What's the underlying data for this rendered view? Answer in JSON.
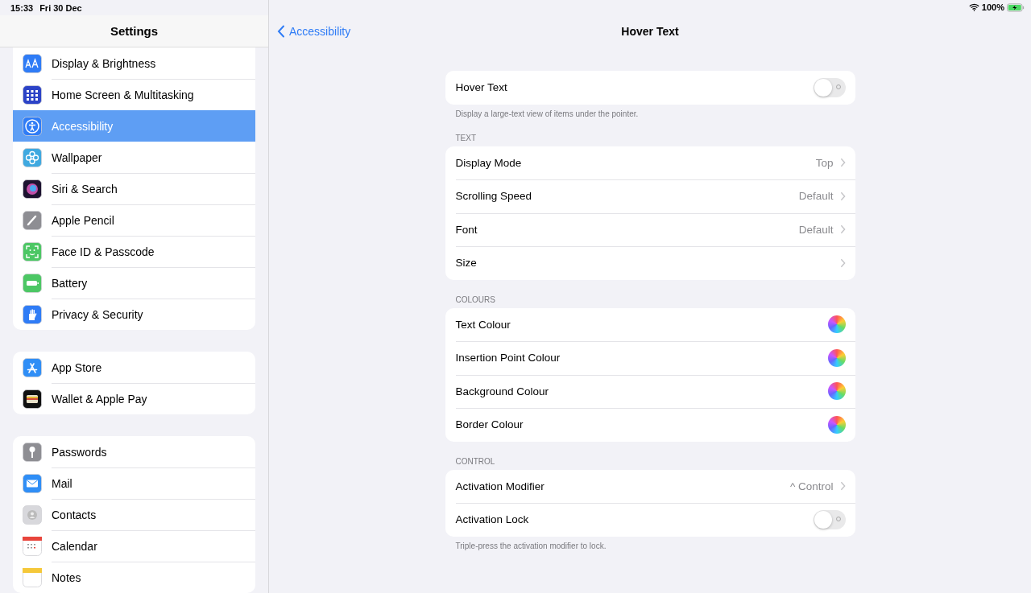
{
  "status_bar": {
    "time": "15:33",
    "date": "Fri 30 Dec",
    "battery": "100%"
  },
  "sidebar": {
    "title": "Settings",
    "groups": [
      [
        {
          "label": "Display & Brightness",
          "kind": "display",
          "selected": false
        },
        {
          "label": "Home Screen & Multitasking",
          "kind": "home",
          "selected": false
        },
        {
          "label": "Accessibility",
          "kind": "accessibility",
          "selected": true
        },
        {
          "label": "Wallpaper",
          "kind": "wallpaper",
          "selected": false
        },
        {
          "label": "Siri & Search",
          "kind": "siri",
          "selected": false
        },
        {
          "label": "Apple Pencil",
          "kind": "pencil",
          "selected": false
        },
        {
          "label": "Face ID & Passcode",
          "kind": "faceid",
          "selected": false
        },
        {
          "label": "Battery",
          "kind": "battery",
          "selected": false
        },
        {
          "label": "Privacy & Security",
          "kind": "privacy",
          "selected": false
        }
      ],
      [
        {
          "label": "App Store",
          "kind": "appstore",
          "selected": false
        },
        {
          "label": "Wallet & Apple Pay",
          "kind": "wallet",
          "selected": false
        }
      ],
      [
        {
          "label": "Passwords",
          "kind": "passwords",
          "selected": false
        },
        {
          "label": "Mail",
          "kind": "mail",
          "selected": false
        },
        {
          "label": "Contacts",
          "kind": "contacts",
          "selected": false
        },
        {
          "label": "Calendar",
          "kind": "calendar",
          "selected": false
        },
        {
          "label": "Notes",
          "kind": "notes",
          "selected": false
        }
      ]
    ]
  },
  "detail": {
    "back": "Accessibility",
    "title": "Hover Text",
    "sections": [
      {
        "rows": [
          {
            "kind": "toggle",
            "label": "Hover Text",
            "on": false
          }
        ],
        "footer": "Display a large-text view of items under the pointer."
      },
      {
        "header": "TEXT",
        "rows": [
          {
            "kind": "link",
            "label": "Display Mode",
            "value": "Top"
          },
          {
            "kind": "link",
            "label": "Scrolling Speed",
            "value": "Default"
          },
          {
            "kind": "link",
            "label": "Font",
            "value": "Default"
          },
          {
            "kind": "link",
            "label": "Size"
          }
        ]
      },
      {
        "header": "COLOURS",
        "rows": [
          {
            "kind": "colour",
            "label": "Text Colour"
          },
          {
            "kind": "colour",
            "label": "Insertion Point Colour"
          },
          {
            "kind": "colour",
            "label": "Background Colour"
          },
          {
            "kind": "colour",
            "label": "Border Colour"
          }
        ]
      },
      {
        "header": "CONTROL",
        "rows": [
          {
            "kind": "link",
            "label": "Activation Modifier",
            "value": "^ Control"
          },
          {
            "kind": "toggle",
            "label": "Activation Lock",
            "on": false
          }
        ],
        "footer": "Triple-press the activation modifier to lock."
      }
    ]
  }
}
